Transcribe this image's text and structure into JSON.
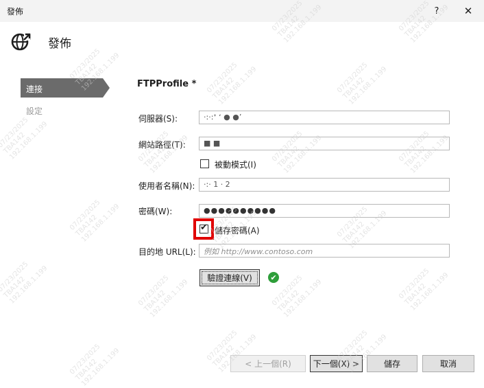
{
  "window": {
    "title": "發佈",
    "help_label": "?",
    "close_label": "✕"
  },
  "header": {
    "icon": "globe-publish-icon",
    "title": "發佈"
  },
  "nav": {
    "items": [
      {
        "label": "連接",
        "selected": true
      },
      {
        "label": "設定",
        "selected": false
      }
    ]
  },
  "profile": {
    "name": "FTPProfile *"
  },
  "form": {
    "server": {
      "label": "伺服器(S):",
      "value": "·:·:ᐩ ʻ ● ●ʼ"
    },
    "site_path": {
      "label": "網站路徑(T):",
      "value": "■    ■"
    },
    "passive_mode": {
      "label": "被動模式(I)",
      "checked": false
    },
    "username": {
      "label": "使用者名稱(N):",
      "value": "·:· 1 · 2"
    },
    "password": {
      "label": "密碼(W):",
      "value": "●●●●●●●●●●"
    },
    "save_password": {
      "label": "儲存密碼(A)",
      "checked": true
    },
    "dest_url": {
      "label": "目的地 URL(L):",
      "value": "",
      "placeholder": "例如 http://www.contoso.com"
    }
  },
  "validate": {
    "label": "驗證連線(V)",
    "status_icon": "success-check-icon",
    "status_color": "#2e9e3a"
  },
  "footer": {
    "prev_label": "< 上一個(R)",
    "next_label": "下一個(X) >",
    "save_label": "儲存",
    "cancel_label": "取消"
  },
  "watermark": {
    "lines": "07/23/2025\nTBA142\n192.168.1.199"
  },
  "colors": {
    "highlight": "#e00000",
    "nav_selected": "#6b6b6b"
  }
}
